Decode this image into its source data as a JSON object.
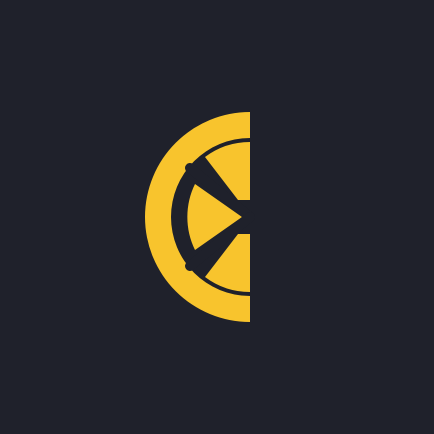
{
  "app_icon": {
    "logo_name": "lemon-slice-logo",
    "colors": {
      "background": "#1f212b",
      "lemon": "#f8c42d"
    }
  }
}
